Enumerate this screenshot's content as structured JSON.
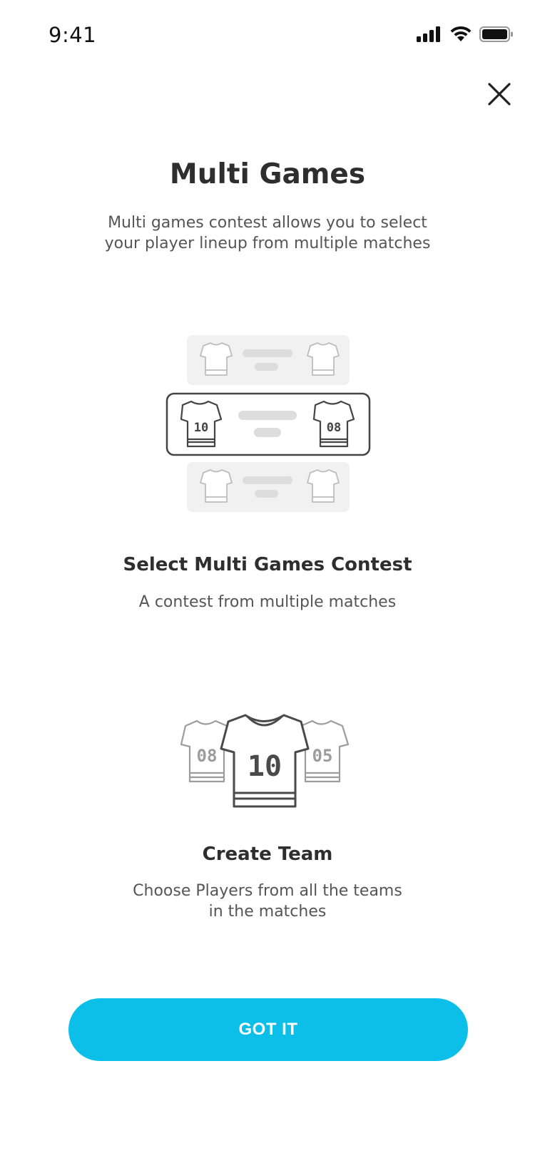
{
  "status_bar": {
    "time": "9:41",
    "icons": [
      "cellular-signal-icon",
      "wifi-icon",
      "battery-icon"
    ]
  },
  "modal": {
    "close_icon": "close-icon",
    "title": "Multi Games",
    "subtitle": "Multi games contest allows you to select your player lineup from multiple matches"
  },
  "steps": [
    {
      "title": "Select Multi Games Contest",
      "description": "A contest from multiple matches",
      "illustration": "match-list-illustration",
      "jersey_numbers": [
        "10",
        "08"
      ]
    },
    {
      "title": "Create Team",
      "description": "Choose Players from all the teams in the matches",
      "illustration": "team-jerseys-illustration",
      "jersey_numbers": [
        "08",
        "10",
        "05"
      ]
    }
  ],
  "cta": {
    "label": "GOT IT",
    "color": "#0cbfe9"
  }
}
